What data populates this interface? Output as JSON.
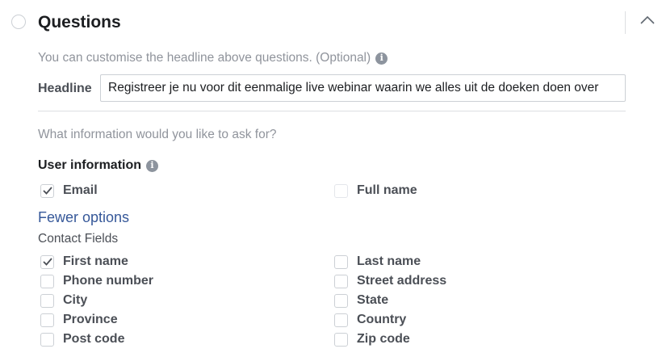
{
  "section": {
    "title": "Questions",
    "collapse_icon": "chevron-up-icon"
  },
  "headline": {
    "hint": "You can customise the headline above questions. (Optional)",
    "label": "Headline",
    "value": "Registreer je nu voor dit eenmalige live webinar waarin we alles uit de doeken doen over"
  },
  "question_prompt": "What information would you like to ask for?",
  "user_information": {
    "title": "User information",
    "options": [
      {
        "label": "Email",
        "checked": true,
        "disabled": false
      },
      {
        "label": "Full name",
        "checked": false,
        "disabled": true
      }
    ]
  },
  "fewer_options_label": "Fewer options",
  "contact_fields": {
    "title": "Contact Fields",
    "left": [
      {
        "label": "First name",
        "checked": true
      },
      {
        "label": "Phone number",
        "checked": false
      },
      {
        "label": "City",
        "checked": false
      },
      {
        "label": "Province",
        "checked": false
      },
      {
        "label": "Post code",
        "checked": false
      }
    ],
    "right": [
      {
        "label": "Last name",
        "checked": false
      },
      {
        "label": "Street address",
        "checked": false
      },
      {
        "label": "State",
        "checked": false
      },
      {
        "label": "Country",
        "checked": false
      },
      {
        "label": "Zip code",
        "checked": false
      }
    ]
  },
  "colors": {
    "link": "#365899",
    "muted_text": "#90949c",
    "label_text": "#4b4f56",
    "border": "#ccd0d5"
  }
}
